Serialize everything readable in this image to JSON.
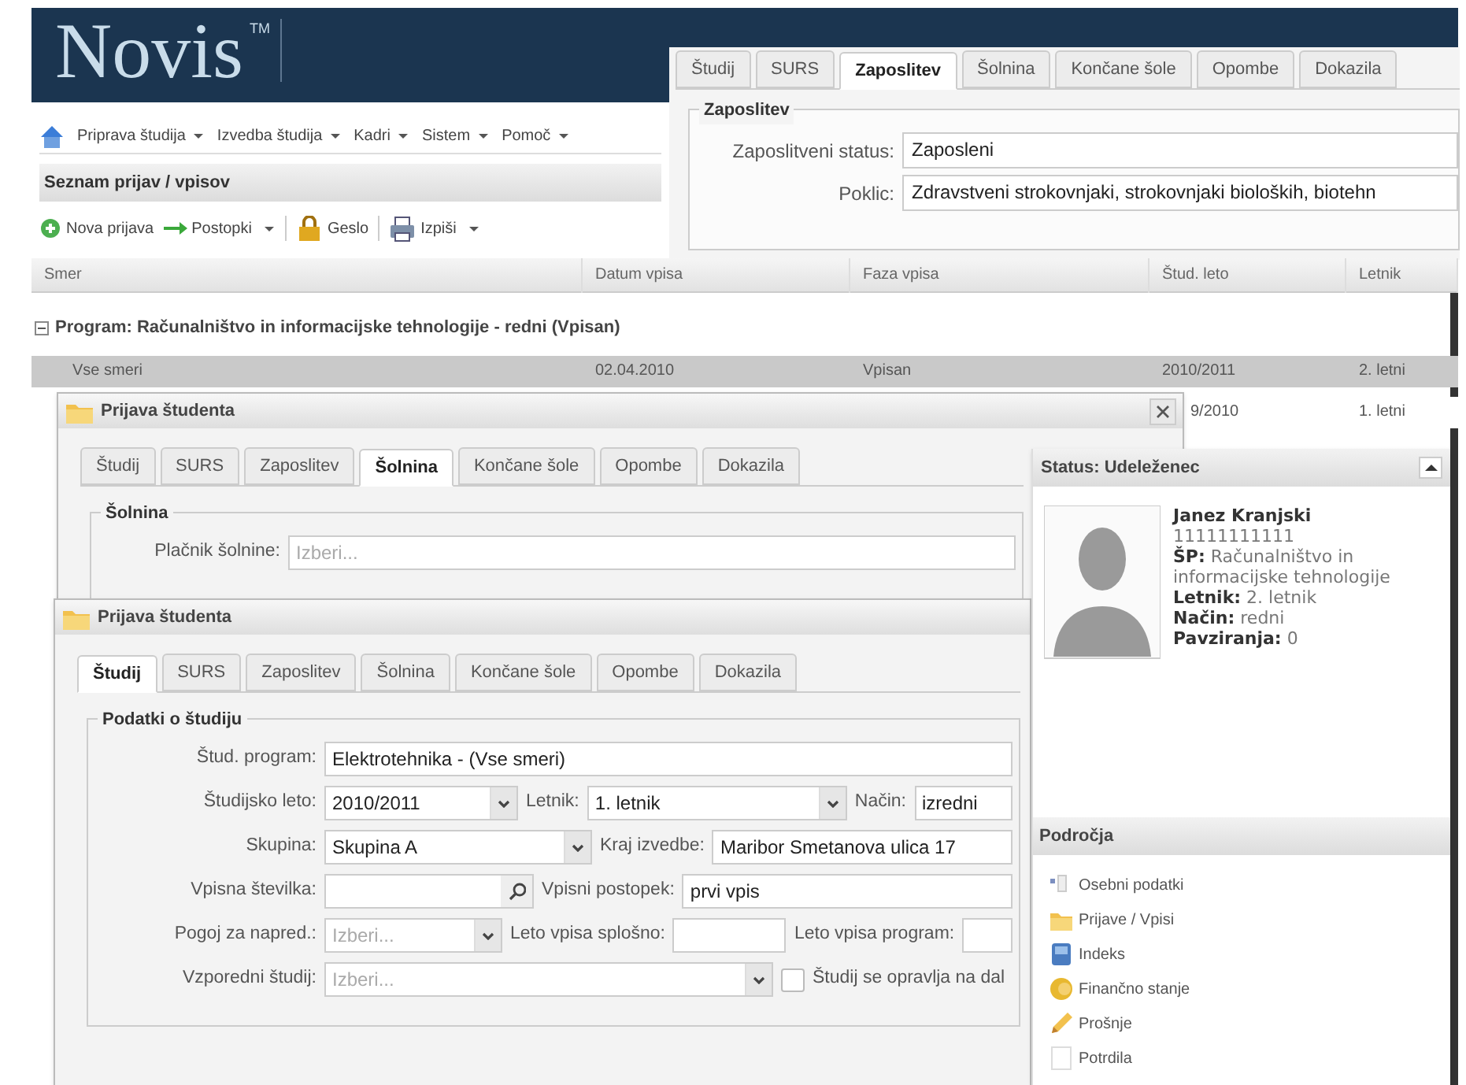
{
  "logo": {
    "name": "Novis",
    "mark": "TM"
  },
  "menu": [
    {
      "label": "Priprava študija",
      "dropdown": true
    },
    {
      "label": "Izvedba študija",
      "dropdown": true
    },
    {
      "label": "Kadri",
      "dropdown": true
    },
    {
      "label": "Sistem",
      "dropdown": true
    },
    {
      "label": "Pomoč",
      "dropdown": true
    }
  ],
  "list_panel": {
    "title": "Seznam prijav / vpisov"
  },
  "toolbar": [
    {
      "kind": "new",
      "label": "Nova prijava",
      "dropdown": false
    },
    {
      "kind": "arrow",
      "label": "Postopki",
      "dropdown": true
    },
    {
      "kind": "lock",
      "label": "Geslo",
      "dropdown": false
    },
    {
      "kind": "print",
      "label": "Izpiši",
      "dropdown": true
    }
  ],
  "employment_panel": {
    "tabs": [
      {
        "label": "Študij",
        "selected": false
      },
      {
        "label": "SURS",
        "selected": false
      },
      {
        "label": "Zaposlitev",
        "selected": true
      },
      {
        "label": "Šolnina",
        "selected": false
      },
      {
        "label": "Končane šole",
        "selected": false
      },
      {
        "label": "Opombe",
        "selected": false
      },
      {
        "label": "Dokazila",
        "selected": false
      }
    ],
    "legend": "Zaposlitev",
    "fields": [
      {
        "label": "Zaposlitveni status:",
        "value": "Zaposleni"
      },
      {
        "label": "Poklic:",
        "value": "Zdravstveni strokovnjaki, strokovnjaki bioloških, biotehn"
      }
    ]
  },
  "grid": {
    "columns": [
      "Smer",
      "Datum vpisa",
      "Faza vpisa",
      "Štud. leto",
      "Letnik"
    ],
    "group": {
      "label": "Program: Računalništvo in informacijske tehnologije - redni (Vpisan)",
      "expanded": true
    },
    "rows": [
      {
        "cells": [
          "Vse smeri",
          "02.04.2010",
          "Vpisan",
          "2010/2011",
          "2. letni"
        ],
        "selected": true
      },
      {
        "cells": [
          null,
          null,
          null,
          "9/2010",
          "1. letni"
        ],
        "selected": false
      }
    ]
  },
  "windows": [
    {
      "title": "Prijava študenta",
      "closable": true,
      "tabs": [
        {
          "label": "Študij",
          "selected": false
        },
        {
          "label": "SURS",
          "selected": false
        },
        {
          "label": "Zaposlitev",
          "selected": false
        },
        {
          "label": "Šolnina",
          "selected": true
        },
        {
          "label": "Končane šole",
          "selected": false
        },
        {
          "label": "Opombe",
          "selected": false
        },
        {
          "label": "Dokazila",
          "selected": false
        }
      ],
      "legend": "Šolnina",
      "rows": [
        [
          {
            "kind": "text",
            "label": "Plačnik šolnine:",
            "placeholder": "Izberi..."
          }
        ]
      ]
    },
    {
      "title": "Prijava študenta",
      "closable": false,
      "tabs": [
        {
          "label": "Študij",
          "selected": true
        },
        {
          "label": "SURS",
          "selected": false
        },
        {
          "label": "Zaposlitev",
          "selected": false
        },
        {
          "label": "Šolnina",
          "selected": false
        },
        {
          "label": "Končane šole",
          "selected": false
        },
        {
          "label": "Opombe",
          "selected": false
        },
        {
          "label": "Dokazila",
          "selected": false
        }
      ],
      "legend": "Podatki o študiju",
      "rows": [
        [
          {
            "kind": "text",
            "label": "Štud. program:",
            "value": "Elektrotehnika - (Vse smeri)"
          }
        ],
        [
          {
            "kind": "select",
            "label": "Študijsko leto:",
            "value": "2010/2011"
          },
          {
            "kind": "select",
            "label": "Letnik:",
            "value": "1. letnik"
          },
          {
            "kind": "text",
            "label": "Način:",
            "value": "izredni"
          }
        ],
        [
          {
            "kind": "select",
            "label": "Skupina:",
            "value": "Skupina A"
          },
          {
            "kind": "text",
            "label": "Kraj izvedbe:",
            "value": "Maribor Smetanova ulica 17"
          }
        ],
        [
          {
            "kind": "search",
            "label": "Vpisna številka:"
          },
          {
            "kind": "text",
            "label": "Vpisni postopek:",
            "value": "prvi vpis"
          }
        ],
        [
          {
            "kind": "select",
            "label": "Pogoj za napred.:",
            "placeholder": "Izberi..."
          },
          {
            "kind": "text",
            "label": "Leto vpisa splošno:"
          },
          {
            "kind": "text",
            "label": "Leto vpisa program:"
          }
        ],
        [
          {
            "kind": "select",
            "label": "Vzporedni študij:",
            "placeholder": "Izberi..."
          },
          {
            "kind": "checkbox",
            "label": "Študij se opravlja na dal",
            "checked": false
          }
        ]
      ]
    }
  ],
  "status_panel": {
    "title": "Status: Udeleženec",
    "expanded": true,
    "name": "Janez Kranjski",
    "id": "11111111111",
    "details": [
      {
        "label": "ŠP:",
        "value": "Računalništvo in informacijske tehnologije"
      },
      {
        "label": "Letnik:",
        "value": "2. letnik"
      },
      {
        "label": "Način:",
        "value": "redni"
      },
      {
        "label": "Pavziranja:",
        "value": "0"
      }
    ]
  },
  "areas": {
    "title": "Področja",
    "items": [
      {
        "kind": "personal",
        "label": "Osebni podatki"
      },
      {
        "kind": "folder",
        "label": "Prijave / Vpisi"
      },
      {
        "kind": "book",
        "label": "Indeks"
      },
      {
        "kind": "coins",
        "label": "Finančno stanje"
      },
      {
        "kind": "pencil",
        "label": "Prošnje"
      },
      {
        "kind": "page",
        "label": "Potrdila"
      }
    ]
  }
}
